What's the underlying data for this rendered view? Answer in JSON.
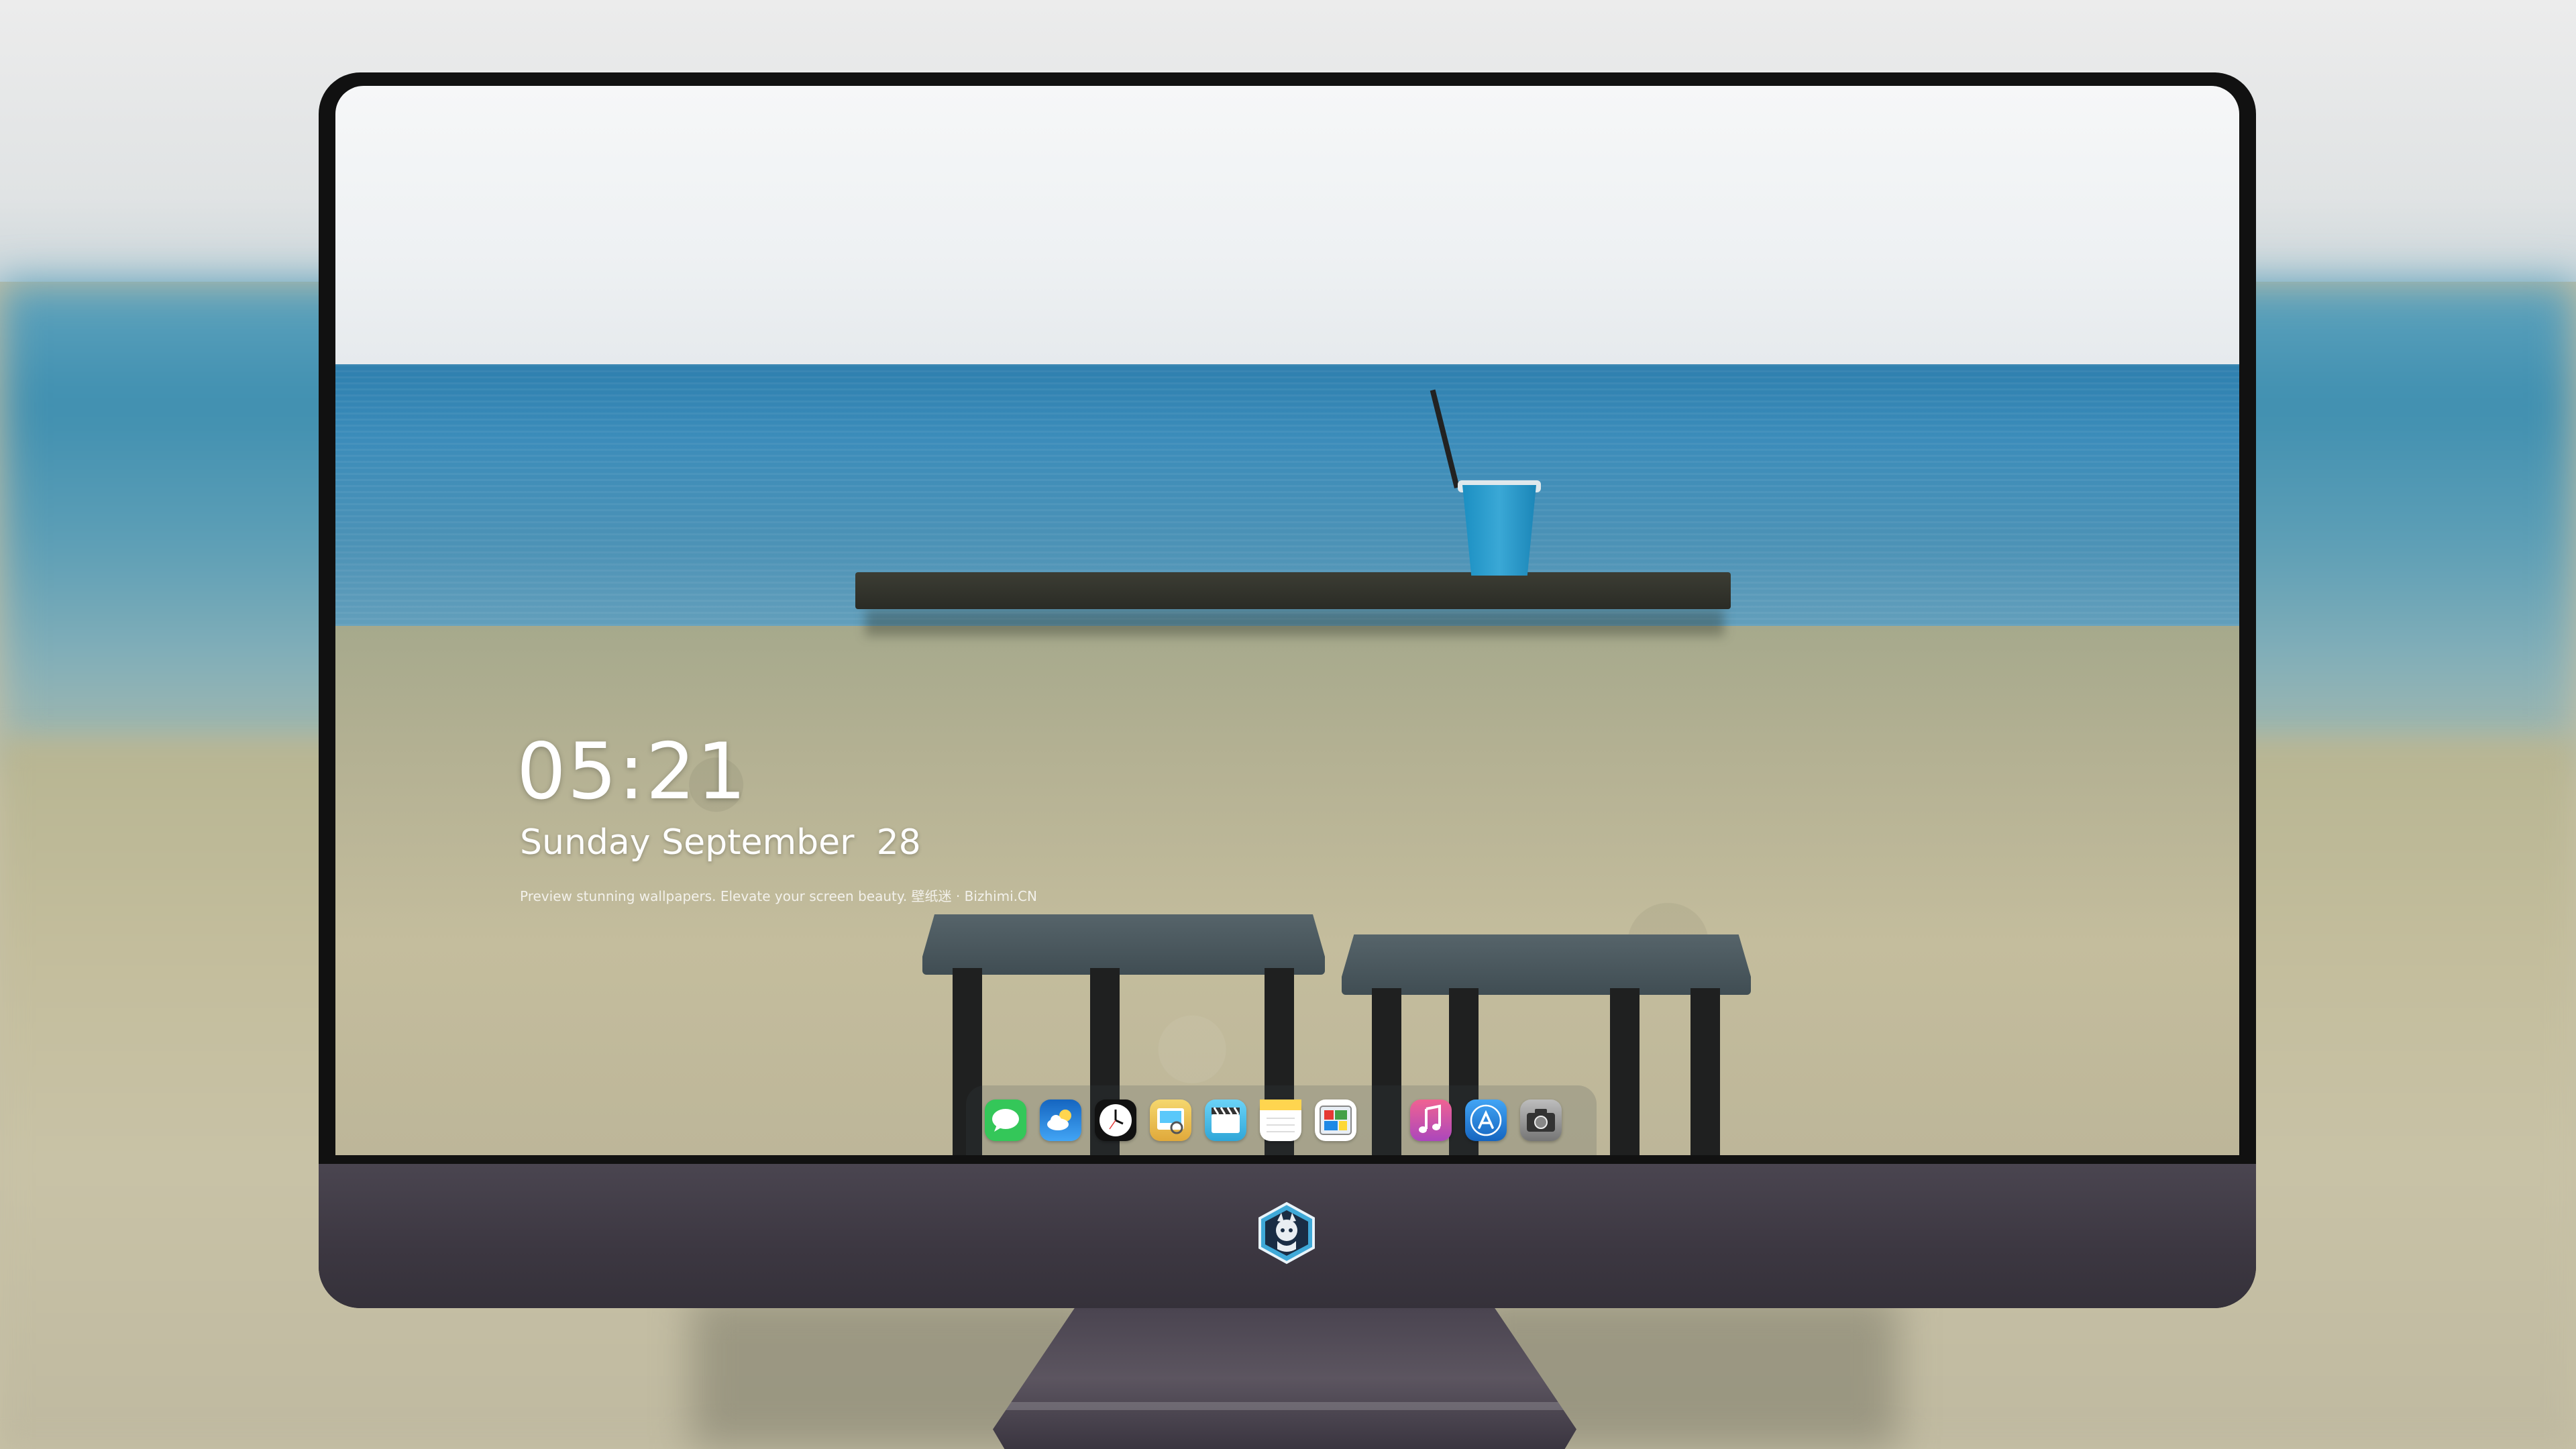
{
  "lock_screen": {
    "time": "05:21",
    "date": "Sunday September  28",
    "tagline": "Preview stunning wallpapers. Elevate your screen beauty. 壁纸迷 · Bizhimi.CN"
  },
  "dock": {
    "apps": [
      {
        "name": "messages-icon",
        "color": "#34c759"
      },
      {
        "name": "weather-icon",
        "color": "#1e88e5"
      },
      {
        "name": "clock-icon",
        "color": "#111111"
      },
      {
        "name": "preview-icon",
        "color": "#f2c94c"
      },
      {
        "name": "video-icon",
        "color": "#5ac8fa"
      },
      {
        "name": "notes-icon",
        "color": "#ffd54f"
      },
      {
        "name": "photo-editor-icon",
        "color": "#ffffff"
      },
      {
        "name": "music-icon",
        "color": "#e040fb"
      },
      {
        "name": "app-store-icon",
        "color": "#1e88e5"
      },
      {
        "name": "camera-icon",
        "color": "#9e9e9e"
      }
    ]
  }
}
